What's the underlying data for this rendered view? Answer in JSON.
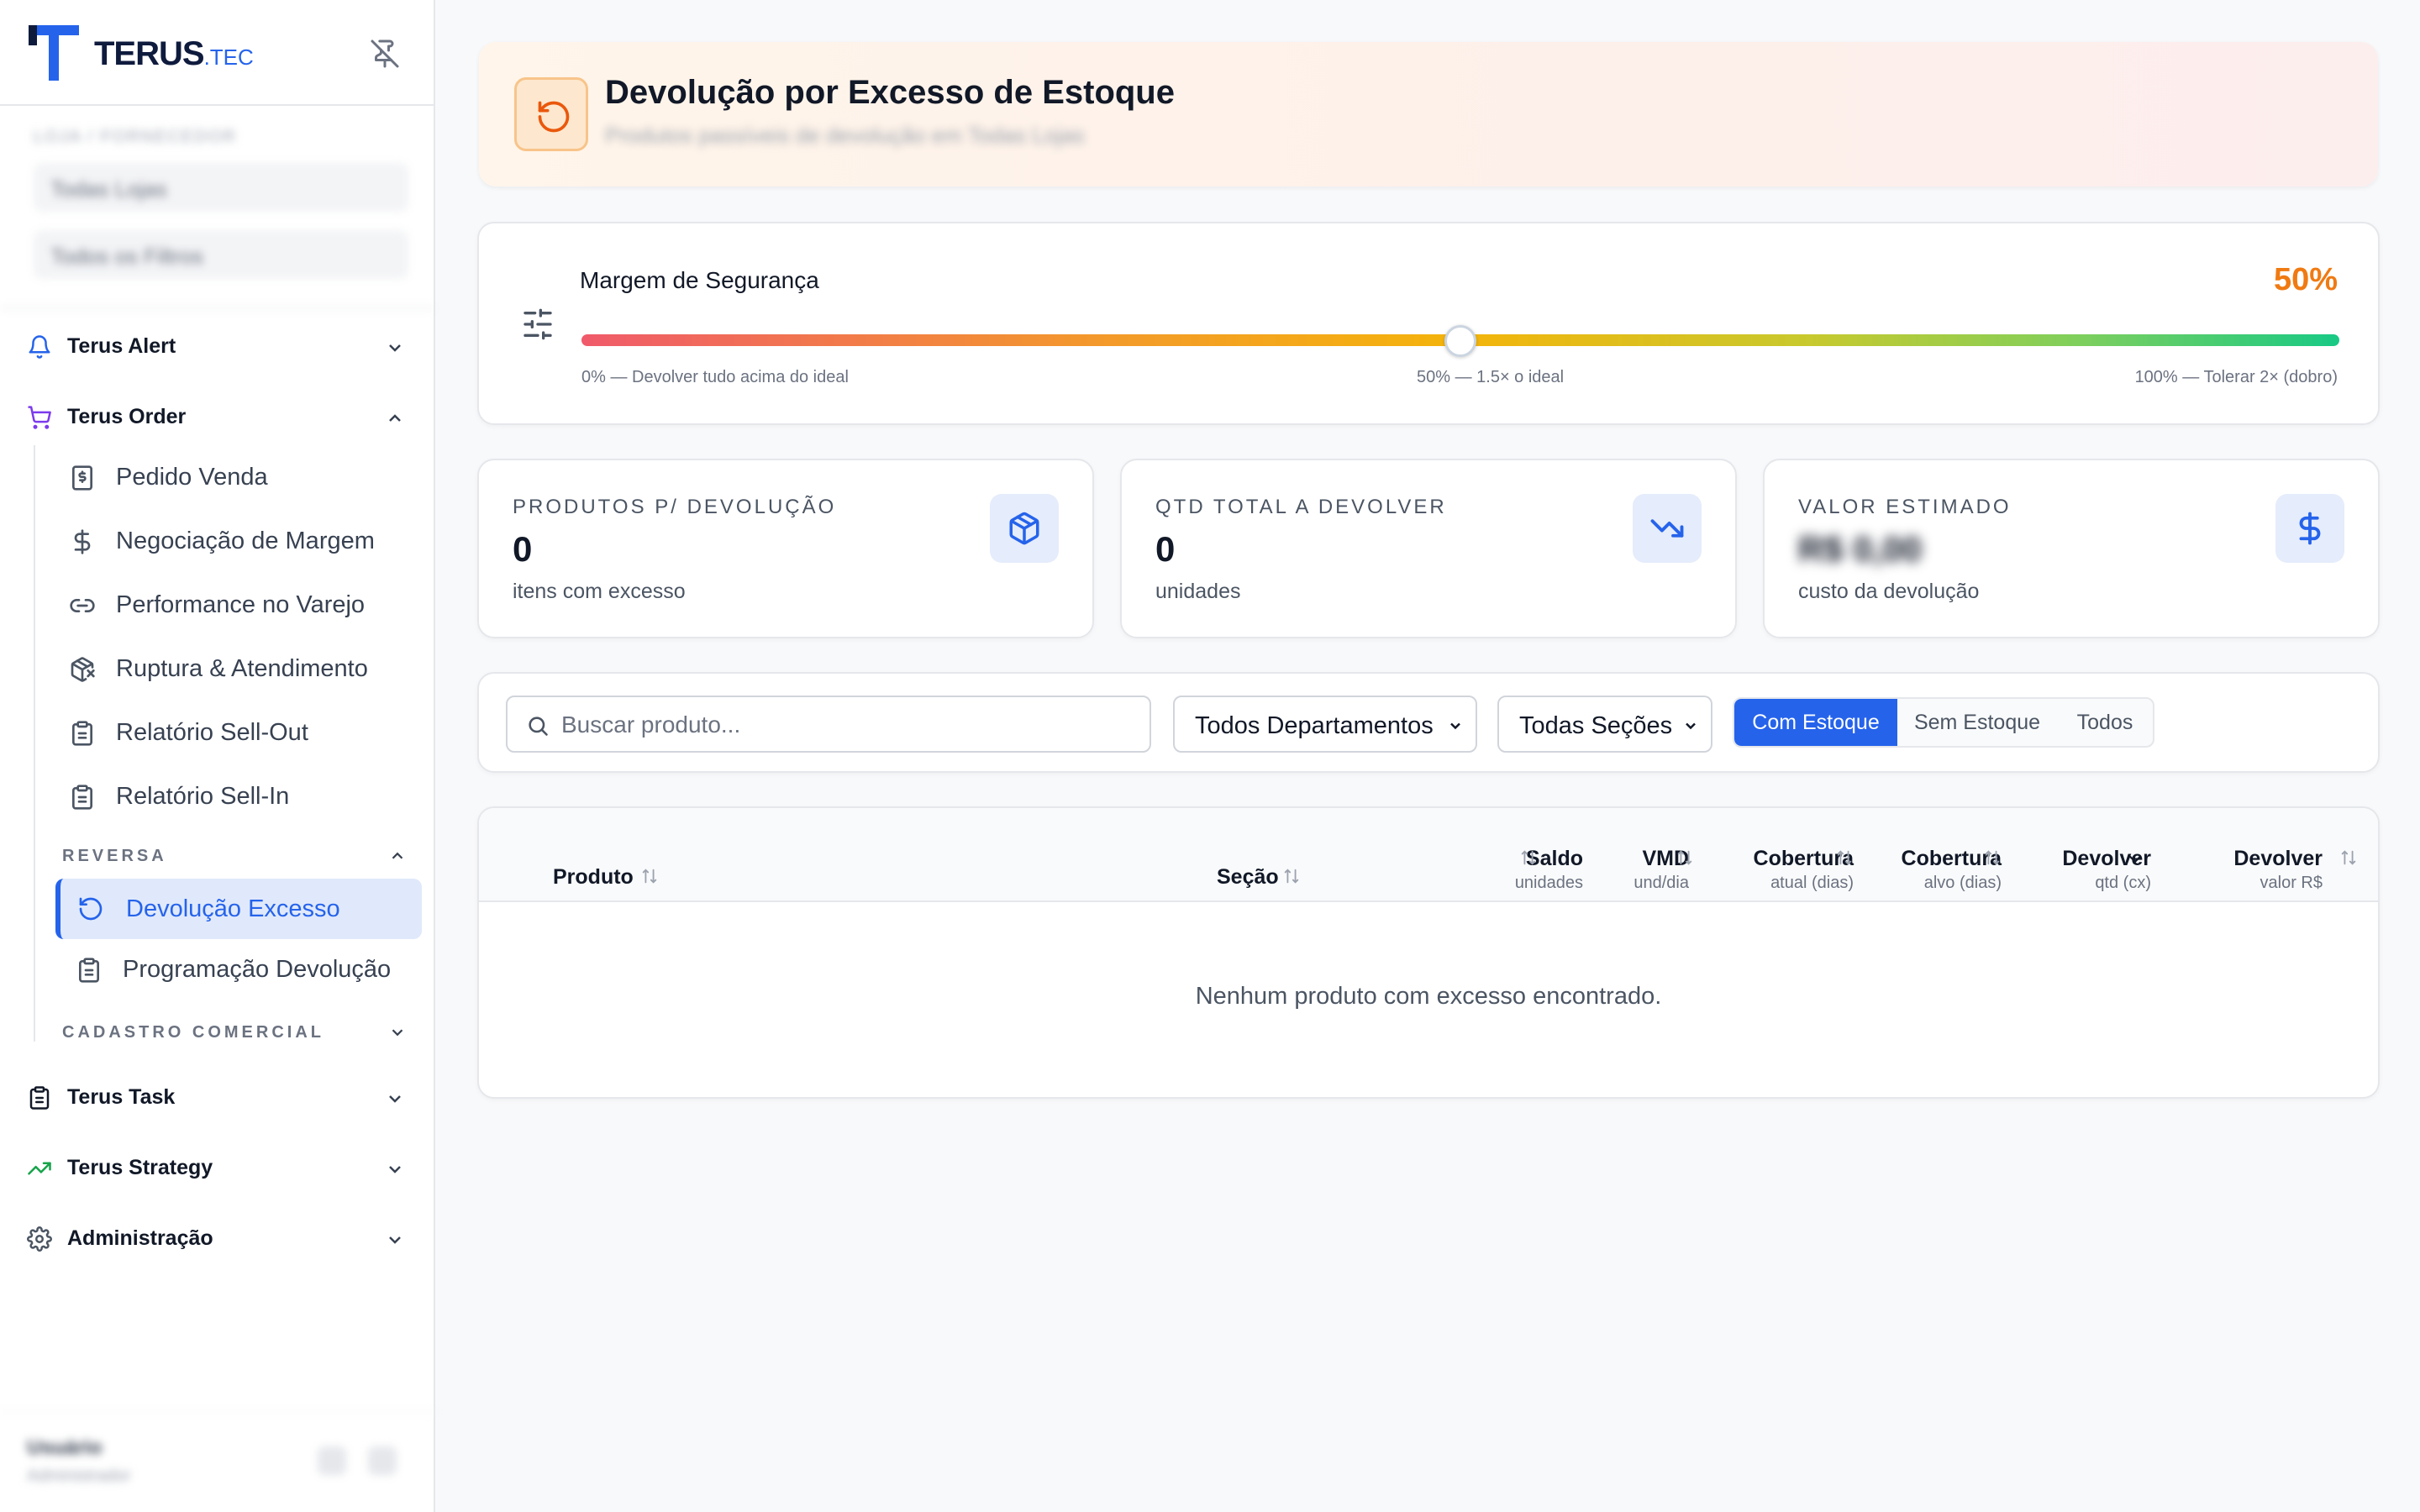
{
  "brand": {
    "name": "TERUS",
    "suffix": ".TEC",
    "colors": {
      "primary": "#2563eb",
      "accent": "#f07a12"
    }
  },
  "sidebar": {
    "filters_label": "LOJA / FORNECEDOR",
    "filter_1": "Todas Lojas",
    "filter_2": "Todos os Filtros",
    "groups": [
      {
        "label": "Terus Alert",
        "icon": "bell-icon"
      },
      {
        "label": "Terus Order",
        "icon": "cart-icon"
      },
      {
        "label": "Terus Task",
        "icon": "clipboard-icon"
      },
      {
        "label": "Terus Strategy",
        "icon": "trending-up-icon"
      },
      {
        "label": "Administração",
        "icon": "gear-icon"
      }
    ],
    "order_items": [
      {
        "label": "Pedido Venda",
        "icon": "receipt-icon"
      },
      {
        "label": "Negociação de Margem",
        "icon": "dollar-icon"
      },
      {
        "label": "Performance no Varejo",
        "icon": "link-icon"
      },
      {
        "label": "Ruptura & Atendimento",
        "icon": "package-x-icon"
      },
      {
        "label": "Relatório Sell-Out",
        "icon": "clipboard-icon"
      },
      {
        "label": "Relatório Sell-In",
        "icon": "clipboard-icon"
      }
    ],
    "section_reversa": "REVERSA",
    "reversa_items": [
      {
        "label": "Devolução Excesso",
        "icon": "rotate-ccw-icon",
        "active": true
      },
      {
        "label": "Programação Devolução",
        "icon": "clipboard-icon"
      }
    ],
    "section_cadastro": "CADASTRO COMERCIAL",
    "user": {
      "name": "Usuário",
      "role": "Administrador"
    }
  },
  "header": {
    "title": "Devolução por Excesso de Estoque",
    "subtitle": "Produtos passíveis de devolução em Todas Lojas"
  },
  "margin": {
    "title": "Margem de Segurança",
    "value_text": "50%",
    "value": 0.5,
    "tick_left": "0% — Devolver tudo acima do ideal",
    "tick_mid": "50% — 1.5× o ideal",
    "tick_right": "100% — Tolerar 2× (dobro)"
  },
  "stats": [
    {
      "label": "PRODUTOS P/ DEVOLUÇÃO",
      "value": "0",
      "sub": "itens com excesso",
      "icon": "box-icon"
    },
    {
      "label": "QTD TOTAL A DEVOLVER",
      "value": "0",
      "sub": "unidades",
      "icon": "trending-down-icon"
    },
    {
      "label": "VALOR ESTIMADO",
      "value": "R$ 0,00",
      "sub": "custo da devolução",
      "icon": "dollar-icon"
    }
  ],
  "filters": {
    "search_placeholder": "Buscar produto...",
    "departments": "Todos Departamentos",
    "sections": "Todas Seções",
    "stock_tabs": [
      "Com Estoque",
      "Sem Estoque",
      "Todos"
    ]
  },
  "table": {
    "columns": [
      {
        "label": "Produto",
        "sub": ""
      },
      {
        "label": "Seção",
        "sub": ""
      },
      {
        "label": "Saldo",
        "sub": "unidades"
      },
      {
        "label": "VMD",
        "sub": "und/dia"
      },
      {
        "label": "Cobertura",
        "sub": "atual (dias)"
      },
      {
        "label": "Cobertura",
        "sub": "alvo (dias)"
      },
      {
        "label": "Devolver",
        "sub": "qtd (cx)"
      },
      {
        "label": "Devolver",
        "sub": "valor R$"
      }
    ],
    "empty_message": "Nenhum produto com excesso encontrado."
  }
}
